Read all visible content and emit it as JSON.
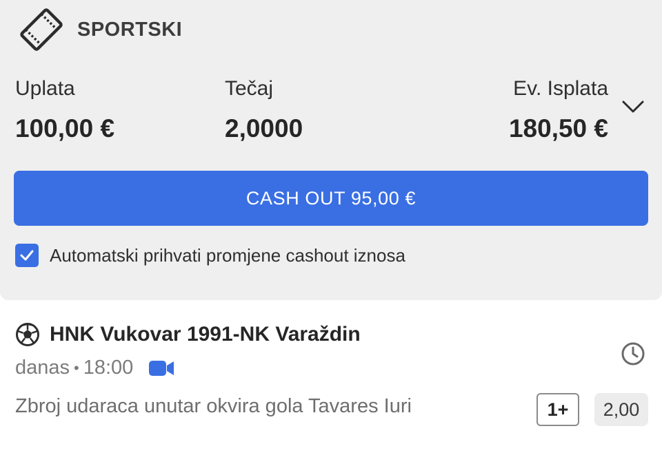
{
  "header": {
    "title": "SPORTSKI",
    "icon": "ticket-icon"
  },
  "summary": {
    "uplata": {
      "label": "Uplata",
      "value": "100,00 €"
    },
    "tecaj": {
      "label": "Tečaj",
      "value": "2,0000"
    },
    "isplata": {
      "label": "Ev. Isplata",
      "value": "180,50 €"
    }
  },
  "cashout": {
    "label": "CASH OUT 95,00 €",
    "color": "#3a6fe3"
  },
  "auto_accept": {
    "label": "Automatski prihvati promjene cashout iznosa",
    "checked": true
  },
  "event": {
    "sport_icon": "soccer-ball-icon",
    "title": "HNK Vukovar 1991-NK Varaždin",
    "day": "danas",
    "separator": "•",
    "time": "18:00",
    "stream_icon": "video-camera-icon",
    "status_icon": "clock-icon",
    "market": "Zbroj udaraca unutar okvira gola Tavares Iuri",
    "pick": "1+",
    "odds": "2,00"
  }
}
